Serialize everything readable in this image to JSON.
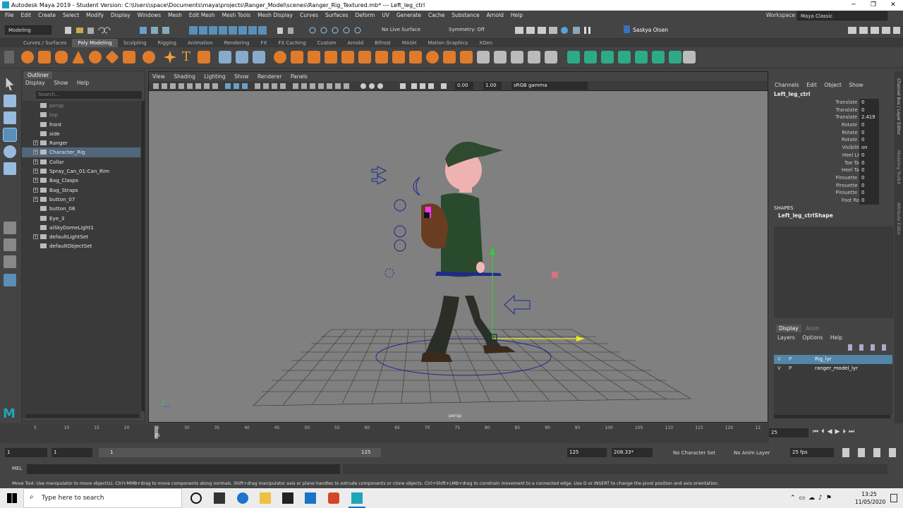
{
  "title": "Autodesk Maya 2019 - Student Version: C:\\Users\\space\\Documents\\maya\\projects\\Ranger_Model\\scenes\\Ranger_Rig_Textured.mb*   ---   Left_leg_ctrl",
  "menu": [
    "File",
    "Edit",
    "Create",
    "Select",
    "Modify",
    "Display",
    "Windows",
    "Mesh",
    "Edit Mesh",
    "Mesh Tools",
    "Mesh Display",
    "Curves",
    "Surfaces",
    "Deform",
    "UV",
    "Generate",
    "Cache",
    "Substance",
    "Arnold",
    "Help"
  ],
  "workspace": {
    "label": "Workspace :",
    "value": "Maya Classic"
  },
  "status": {
    "mode": "Modeling",
    "live_surface": "No Live Surface",
    "symmetry": "Symmetry: Off",
    "user": "Saskya Olsen"
  },
  "shelf_tabs": [
    "Curves / Surfaces",
    "Poly Modeling",
    "Sculpting",
    "Rigging",
    "Animation",
    "Rendering",
    "FX",
    "FX Caching",
    "Custom",
    "Arnold",
    "Bifrost",
    "MASH",
    "Motion Graphics",
    "XGen"
  ],
  "shelf_active": "Poly Modeling",
  "outliner": {
    "tab": "Outliner",
    "menu": [
      "Display",
      "Show",
      "Help"
    ],
    "search_placeholder": "Search...",
    "items": [
      {
        "label": "persp",
        "dim": true,
        "plus": false
      },
      {
        "label": "top",
        "dim": true,
        "plus": false
      },
      {
        "label": "front",
        "dim": false,
        "plus": false
      },
      {
        "label": "side",
        "dim": false,
        "plus": false
      },
      {
        "label": "Ranger",
        "dim": false,
        "plus": true
      },
      {
        "label": "Character_Rig",
        "dim": false,
        "plus": true,
        "selected": true
      },
      {
        "label": "Collar",
        "dim": false,
        "plus": true
      },
      {
        "label": "Spray_Can_01:Can_Rim",
        "dim": false,
        "plus": true
      },
      {
        "label": "Bag_Clasps",
        "dim": false,
        "plus": true
      },
      {
        "label": "Bag_Straps",
        "dim": false,
        "plus": true
      },
      {
        "label": "button_07",
        "dim": false,
        "plus": true
      },
      {
        "label": "button_08",
        "dim": false,
        "plus": false
      },
      {
        "label": "Eye_3",
        "dim": false,
        "plus": false
      },
      {
        "label": "aiSkyDomeLight1",
        "dim": false,
        "plus": false
      },
      {
        "label": "defaultLightSet",
        "dim": false,
        "plus": true
      },
      {
        "label": "defaultObjectSet",
        "dim": false,
        "plus": false
      }
    ]
  },
  "viewport": {
    "menu": [
      "View",
      "Shading",
      "Lighting",
      "Show",
      "Renderer",
      "Panels"
    ],
    "val1": "0.00",
    "val2": "1.00",
    "gamma": "sRGB gamma",
    "camera": "persp"
  },
  "channel_box": {
    "menu": [
      "Channels",
      "Edit",
      "Object",
      "Show"
    ],
    "object": "Left_leg_ctrl",
    "attrs": [
      {
        "n": "Translate X",
        "v": "0"
      },
      {
        "n": "Translate Y",
        "v": "0"
      },
      {
        "n": "Translate Z",
        "v": "2.419"
      },
      {
        "n": "Rotate X",
        "v": "0"
      },
      {
        "n": "Rotate Y",
        "v": "0"
      },
      {
        "n": "Rotate Z",
        "v": "0"
      },
      {
        "n": "Visibility",
        "v": "on"
      },
      {
        "n": "Heel Lift",
        "v": "0"
      },
      {
        "n": "Toe Tap",
        "v": "0"
      },
      {
        "n": "Heel Tap",
        "v": "0"
      },
      {
        "n": "Pirouette X",
        "v": "0"
      },
      {
        "n": "Pirouette Y",
        "v": "0"
      },
      {
        "n": "Pirouette Z",
        "v": "0"
      },
      {
        "n": "Foot Roll",
        "v": "0"
      }
    ],
    "shapes_label": "SHAPES",
    "shape": "Left_leg_ctrlShape"
  },
  "layer_editor": {
    "tabs": [
      "Display",
      "Anim"
    ],
    "menu": [
      "Layers",
      "Options",
      "Help"
    ],
    "layers": [
      {
        "v": "V",
        "p": "P",
        "name": "Rig_lyr",
        "selected": true
      },
      {
        "v": "V",
        "p": "P",
        "name": "ranger_model_lyr",
        "selected": false
      }
    ]
  },
  "side_tabs": [
    "Channel Box / Layer Editor",
    "Modeling Toolkit",
    "Attribute Editor"
  ],
  "timeline": {
    "ticks": [
      "5",
      "10",
      "15",
      "20",
      "25",
      "30",
      "35",
      "40",
      "45",
      "50",
      "55",
      "60",
      "65",
      "70",
      "75",
      "80",
      "85",
      "90",
      "95",
      "100",
      "105",
      "110",
      "115",
      "120",
      "12"
    ],
    "current": "25",
    "current_field": "25"
  },
  "range": {
    "start": "1",
    "start2": "1",
    "slider_start": "1",
    "slider_end": "125",
    "end": "125",
    "end2": "208.33*",
    "char_set": "No Character Set",
    "anim_layer": "No Anim Layer",
    "fps": "25 fps"
  },
  "mel": "MEL",
  "help_line": "Move Tool: Use manipulator to move object(s). Ctrl+MMB+drag to move components along normals. Shift+drag manipulator axis or plane handles to extrude components or clone objects. Ctrl+Shift+LMB+drag to constrain movement to a connected edge. Use D or INSERT to change the pivot position and axis orientation.",
  "taskbar": {
    "search": "Type here to search",
    "time": "13:25",
    "date": "11/05/2020"
  },
  "colors": {
    "accent": "#5285a6",
    "selected_row": "#51667a",
    "maya_teal": "#1fa5b8"
  }
}
